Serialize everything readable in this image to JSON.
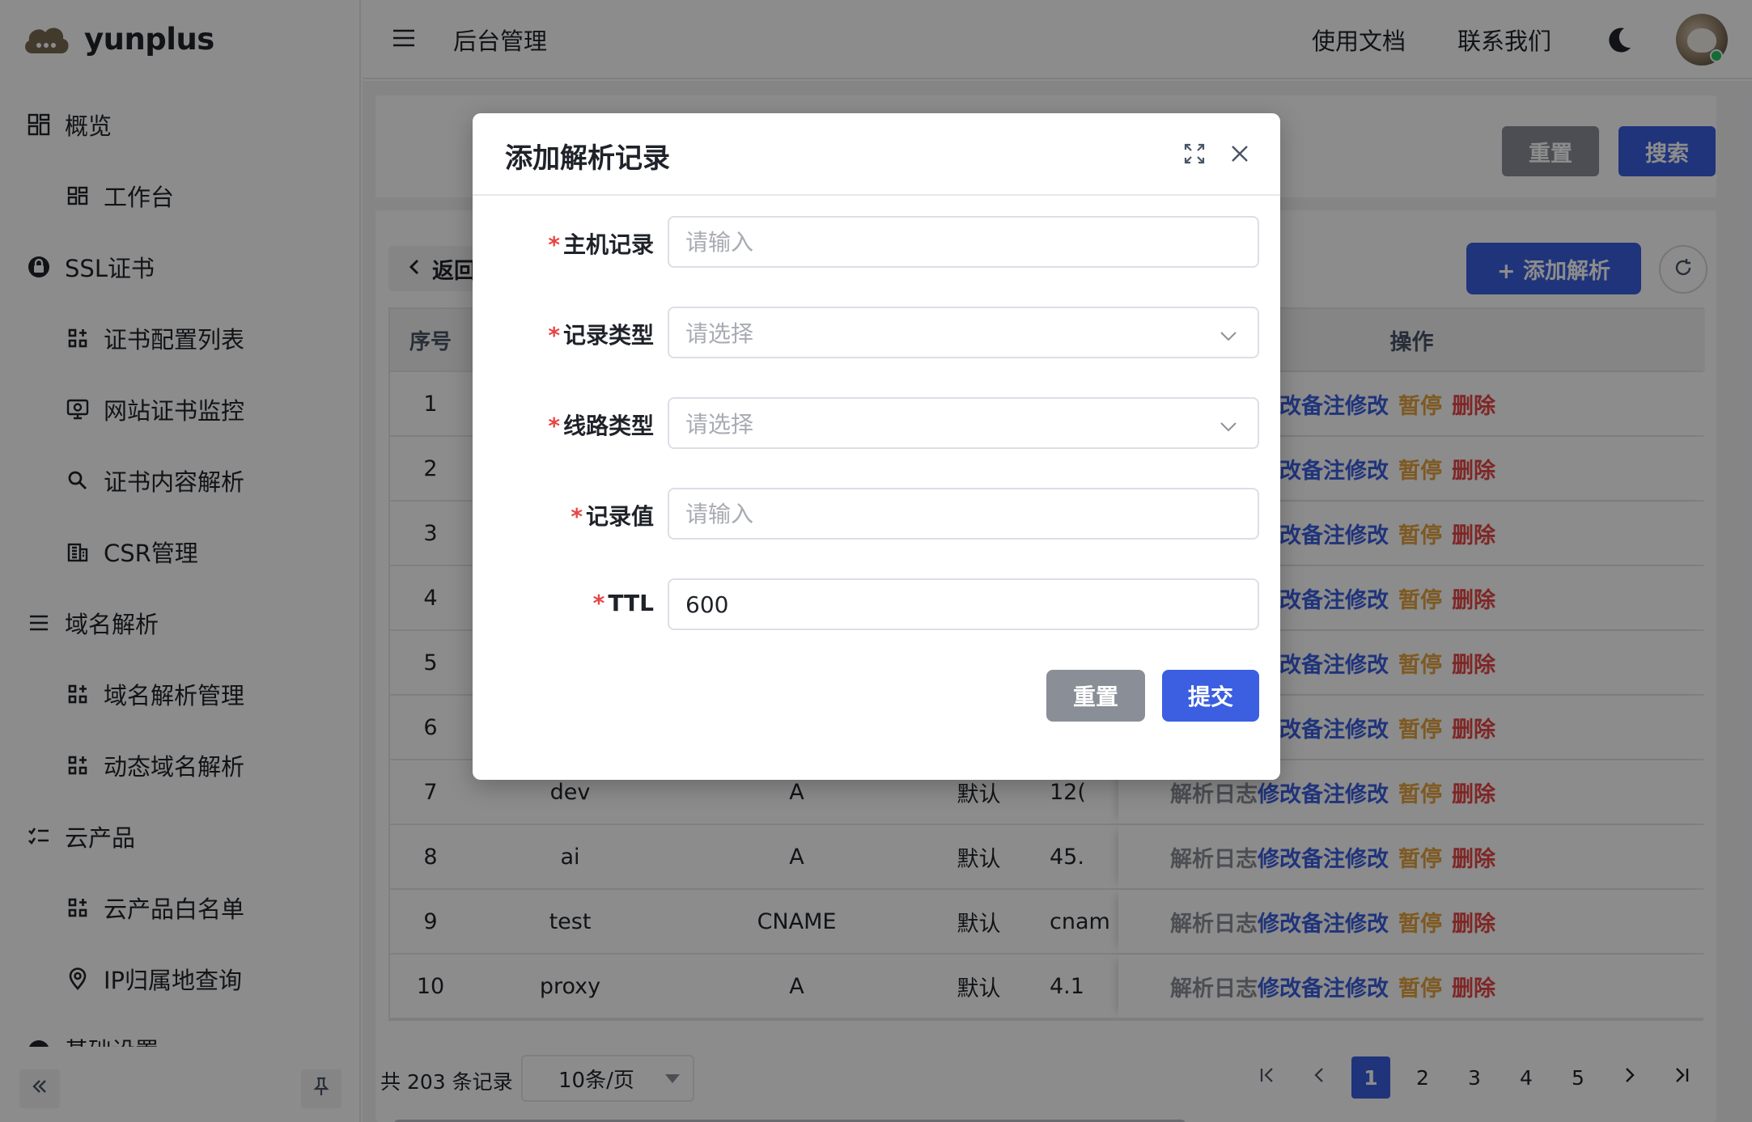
{
  "brand": {
    "name": "yunplus"
  },
  "sidebar": {
    "items": [
      {
        "label": "概览",
        "level": 1,
        "icon": "grid-icon"
      },
      {
        "label": "工作台",
        "level": 2,
        "icon": "grid-icon"
      },
      {
        "label": "SSL证书",
        "level": 1,
        "icon": "lock-icon"
      },
      {
        "label": "证书配置列表",
        "level": 2,
        "icon": "apps-icon"
      },
      {
        "label": "网站证书监控",
        "level": 2,
        "icon": "monitor-icon"
      },
      {
        "label": "证书内容解析",
        "level": 2,
        "icon": "search-icon"
      },
      {
        "label": "CSR管理",
        "level": 2,
        "icon": "building-icon"
      },
      {
        "label": "域名解析",
        "level": 1,
        "icon": "list-icon"
      },
      {
        "label": "域名解析管理",
        "level": 2,
        "icon": "apps-icon"
      },
      {
        "label": "动态域名解析",
        "level": 2,
        "icon": "apps-icon"
      },
      {
        "label": "云产品",
        "level": 1,
        "icon": "checklist-icon"
      },
      {
        "label": "云产品白名单",
        "level": 2,
        "icon": "apps-icon"
      },
      {
        "label": "IP归属地查询",
        "level": 2,
        "icon": "location-icon"
      },
      {
        "label": "基础设置",
        "level": 1,
        "icon": "gauge-icon"
      }
    ]
  },
  "header": {
    "title": "后台管理",
    "docs_label": "使用文档",
    "contact_label": "联系我们"
  },
  "search": {
    "reset_label": "重置",
    "search_label": "搜索"
  },
  "toolbar": {
    "back_label": "返回",
    "add_label": "+ 添加解析"
  },
  "table": {
    "headers": {
      "index": "序号",
      "actions": "操作"
    },
    "actions": {
      "log": "解析日志",
      "note": "修改备注",
      "edit": "修改",
      "pause": "暂停",
      "delete": "删除"
    },
    "rows": [
      {
        "index": "1",
        "host": "",
        "type": "",
        "line": "",
        "value": ""
      },
      {
        "index": "2",
        "host": "",
        "type": "",
        "line": "",
        "value": ""
      },
      {
        "index": "3",
        "host": "",
        "type": "",
        "line": "",
        "value": ""
      },
      {
        "index": "4",
        "host": "",
        "type": "",
        "line": "",
        "value": ""
      },
      {
        "index": "5",
        "host": "",
        "type": "",
        "line": "",
        "value": ""
      },
      {
        "index": "6",
        "host": "",
        "type": "",
        "line": "",
        "value": ""
      },
      {
        "index": "7",
        "host": "dev",
        "type": "A",
        "line": "默认",
        "value": "12("
      },
      {
        "index": "8",
        "host": "ai",
        "type": "A",
        "line": "默认",
        "value": "45."
      },
      {
        "index": "9",
        "host": "test",
        "type": "CNAME",
        "line": "默认",
        "value": "cnam"
      },
      {
        "index": "10",
        "host": "proxy",
        "type": "A",
        "line": "默认",
        "value": "4.1"
      }
    ]
  },
  "pagination": {
    "total_text": "共 203 条记录",
    "page_size": "10条/页",
    "pages": [
      "1",
      "2",
      "3",
      "4",
      "5"
    ],
    "current": "1"
  },
  "modal": {
    "title": "添加解析记录",
    "fields": {
      "host": {
        "label": "主机记录",
        "placeholder": "请输入"
      },
      "record_type": {
        "label": "记录类型",
        "placeholder": "请选择"
      },
      "line_type": {
        "label": "线路类型",
        "placeholder": "请选择"
      },
      "record_value": {
        "label": "记录值",
        "placeholder": "请输入"
      },
      "ttl": {
        "label": "TTL",
        "value": "600"
      }
    },
    "required_mark": "*",
    "reset_label": "重置",
    "submit_label": "提交"
  },
  "colors": {
    "primary": "#3b5fe0",
    "danger": "#e84545",
    "warning": "#e6a23c",
    "muted": "#8a8f97"
  }
}
